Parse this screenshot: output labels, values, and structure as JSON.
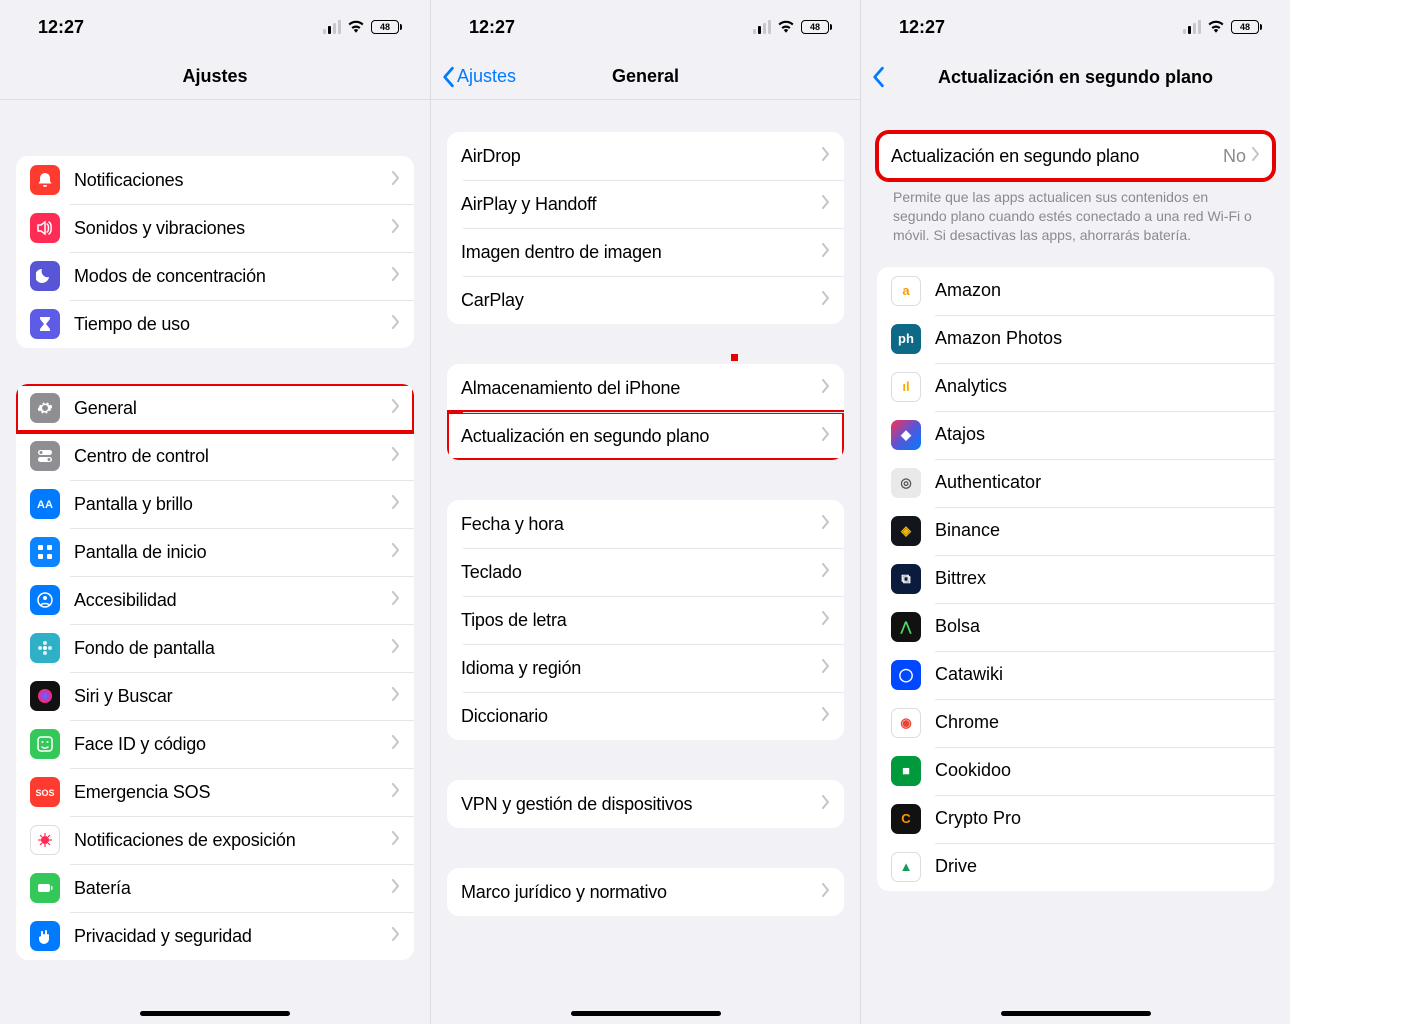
{
  "statusbar": {
    "time": "12:27",
    "battery": "48"
  },
  "screen1": {
    "title": "Ajustes",
    "group1": [
      {
        "label": "Notificaciones",
        "icon": "bell",
        "bg": "bg-red"
      },
      {
        "label": "Sonidos y vibraciones",
        "icon": "speaker",
        "bg": "bg-pink"
      },
      {
        "label": "Modos de concentración",
        "icon": "moon",
        "bg": "bg-purple"
      },
      {
        "label": "Tiempo de uso",
        "icon": "hourglass",
        "bg": "bg-indigo"
      }
    ],
    "group2": [
      {
        "label": "General",
        "icon": "gear",
        "bg": "bg-gray",
        "highlight": true
      },
      {
        "label": "Centro de control",
        "icon": "switches",
        "bg": "bg-gray"
      },
      {
        "label": "Pantalla y brillo",
        "icon": "aa",
        "bg": "bg-blue"
      },
      {
        "label": "Pantalla de inicio",
        "icon": "grid",
        "bg": "bg-dblue"
      },
      {
        "label": "Accesibilidad",
        "icon": "person",
        "bg": "bg-blue"
      },
      {
        "label": "Fondo de pantalla",
        "icon": "flower",
        "bg": "bg-teal"
      },
      {
        "label": "Siri y Buscar",
        "icon": "siri",
        "bg": "bg-black"
      },
      {
        "label": "Face ID y código",
        "icon": "face",
        "bg": "bg-green"
      },
      {
        "label": "Emergencia SOS",
        "icon": "sos",
        "bg": "bg-red"
      },
      {
        "label": "Notificaciones de exposición",
        "icon": "virus",
        "bg": "bg-white"
      },
      {
        "label": "Batería",
        "icon": "battery",
        "bg": "bg-green"
      },
      {
        "label": "Privacidad y seguridad",
        "icon": "hand",
        "bg": "bg-blue"
      }
    ]
  },
  "screen2": {
    "back": "Ajustes",
    "title": "General",
    "group1": [
      {
        "label": "AirDrop"
      },
      {
        "label": "AirPlay y Handoff"
      },
      {
        "label": "Imagen dentro de imagen"
      },
      {
        "label": "CarPlay"
      }
    ],
    "group2": [
      {
        "label": "Almacenamiento del iPhone"
      },
      {
        "label": "Actualización en segundo plano",
        "highlight": true
      }
    ],
    "group3": [
      {
        "label": "Fecha y hora"
      },
      {
        "label": "Teclado"
      },
      {
        "label": "Tipos de letra"
      },
      {
        "label": "Idioma y región"
      },
      {
        "label": "Diccionario"
      }
    ],
    "group4": [
      {
        "label": "VPN y gestión de dispositivos"
      }
    ],
    "group5": [
      {
        "label": "Marco jurídico y normativo"
      }
    ]
  },
  "screen3": {
    "title": "Actualización en segundo plano",
    "master": {
      "label": "Actualización en segundo plano",
      "value": "No",
      "highlight": true
    },
    "footer": "Permite que las apps actualicen sus contenidos en segundo plano cuando estés conectado a una red Wi-Fi o móvil. Si desactivas las apps, ahorrarás batería.",
    "apps": [
      {
        "label": "Amazon",
        "bg": "#fff",
        "fg": "#ff9900",
        "initial": "a"
      },
      {
        "label": "Amazon Photos",
        "bg": "#0d6986",
        "fg": "#fff",
        "initial": "ph"
      },
      {
        "label": "Analytics",
        "bg": "#fff",
        "fg": "#f9ab00",
        "initial": "ıl"
      },
      {
        "label": "Atajos",
        "bg": "linear-gradient(135deg,#ff2d55,#5856d6,#007aff)",
        "fg": "#fff",
        "initial": "◆"
      },
      {
        "label": "Authenticator",
        "bg": "#e9e9e9",
        "fg": "#555",
        "initial": "◎"
      },
      {
        "label": "Binance",
        "bg": "#12161c",
        "fg": "#f0b90b",
        "initial": "◈"
      },
      {
        "label": "Bittrex",
        "bg": "#0a1b3d",
        "fg": "#fff",
        "initial": "⧉"
      },
      {
        "label": "Bolsa",
        "bg": "#111",
        "fg": "#4cd964",
        "initial": "⋀"
      },
      {
        "label": "Catawiki",
        "bg": "#0048ff",
        "fg": "#fff",
        "initial": "◯"
      },
      {
        "label": "Chrome",
        "bg": "#fff",
        "fg": "#ea4335",
        "initial": "◉"
      },
      {
        "label": "Cookidoo",
        "bg": "#009a3d",
        "fg": "#fff",
        "initial": "■"
      },
      {
        "label": "Crypto Pro",
        "bg": "#111",
        "fg": "#ff9500",
        "initial": "C"
      },
      {
        "label": "Drive",
        "bg": "#fff",
        "fg": "#0f9d58",
        "initial": "▲"
      }
    ]
  }
}
